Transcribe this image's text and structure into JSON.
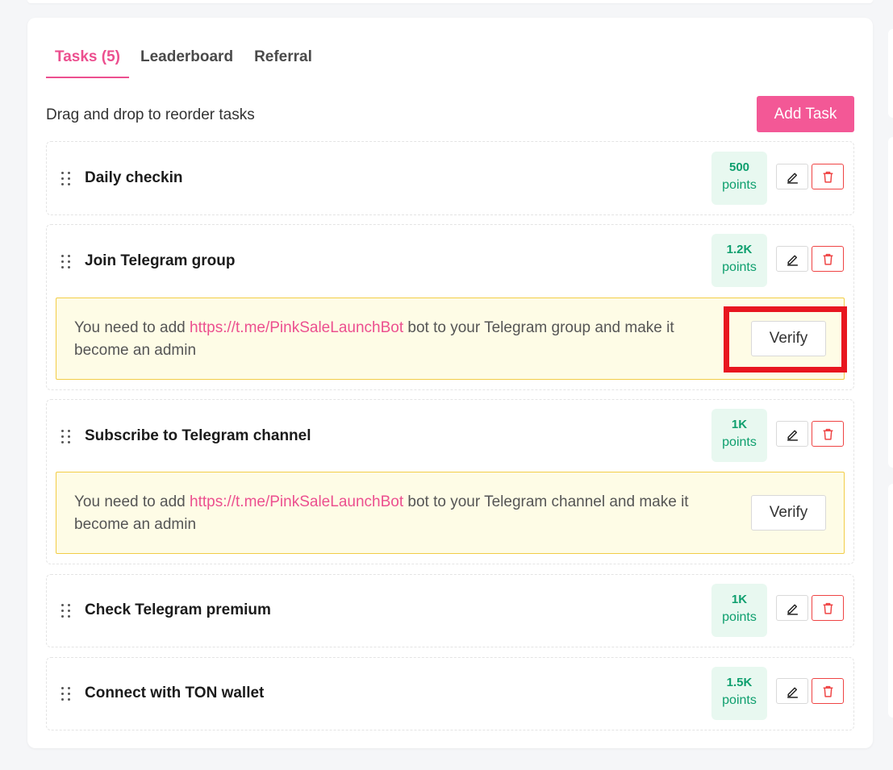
{
  "tabs": [
    {
      "label": "Tasks (5)",
      "active": true
    },
    {
      "label": "Leaderboard",
      "active": false
    },
    {
      "label": "Referral",
      "active": false
    }
  ],
  "hint": "Drag and drop to reorder tasks",
  "add_task_label": "Add Task",
  "tasks": [
    {
      "title": "Daily checkin",
      "points": "500",
      "points_label": "points"
    },
    {
      "title": "Join Telegram group",
      "points": "1.2K",
      "points_label": "points",
      "notice": {
        "prefix": "You need to add ",
        "link": "https://t.me/PinkSaleLaunchBot",
        "suffix": " bot to your Telegram group and make it become an admin",
        "verify_label": "Verify"
      }
    },
    {
      "title": "Subscribe to Telegram channel",
      "points": "1K",
      "points_label": "points",
      "notice": {
        "prefix": "You need to add ",
        "link": "https://t.me/PinkSaleLaunchBot",
        "suffix": " bot to your Telegram channel and make it become an admin",
        "verify_label": "Verify"
      }
    },
    {
      "title": "Check Telegram premium",
      "points": "1K",
      "points_label": "points"
    },
    {
      "title": "Connect with TON wallet",
      "points": "1.5K",
      "points_label": "points"
    }
  ],
  "icons": {
    "edit": "pencil-icon",
    "delete": "trash-icon",
    "drag": "drag-handle-icon"
  },
  "colors": {
    "accent": "#ec4f8f",
    "points_green": "#0e9f6e",
    "danger": "#ef4444",
    "highlight": "#e8161f"
  }
}
